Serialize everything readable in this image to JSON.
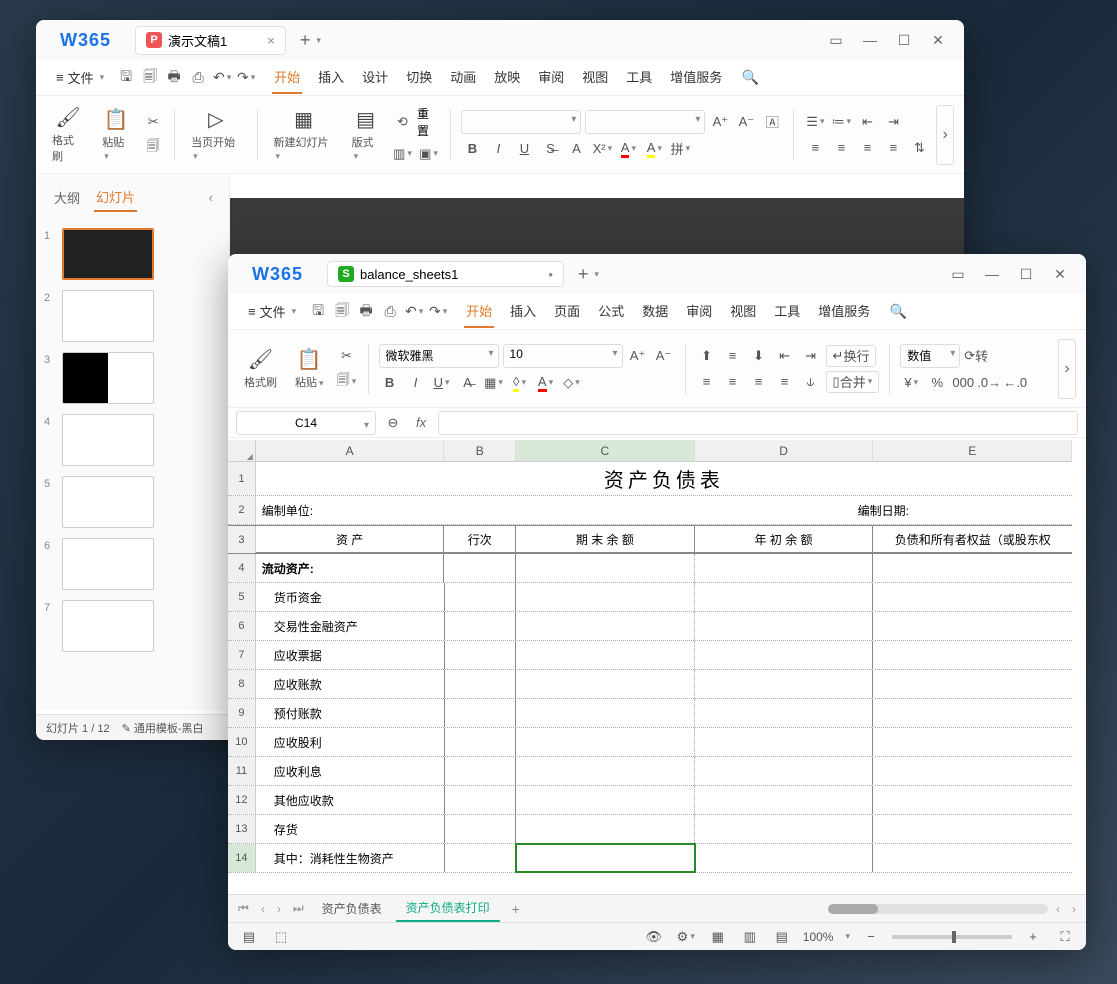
{
  "logo": "W365",
  "ppt": {
    "tab_title": "演示文稿1",
    "menu_file": "文件",
    "menus": [
      "开始",
      "插入",
      "设计",
      "切换",
      "动画",
      "放映",
      "审阅",
      "视图",
      "工具",
      "增值服务"
    ],
    "active_menu": 0,
    "ribbon": {
      "format_painter": "格式刷",
      "paste": "粘贴",
      "from_start": "当页开始",
      "new_slide": "新建幻灯片",
      "layout": "版式",
      "reset": "重置"
    },
    "side": {
      "outline": "大纲",
      "slides": "幻灯片"
    },
    "status": {
      "slide_pos": "幻灯片 1 / 12",
      "template": "通用模板-黑白"
    },
    "thumb_count": 7
  },
  "ss": {
    "tab_title": "balance_sheets1",
    "menu_file": "文件",
    "menus": [
      "开始",
      "插入",
      "页面",
      "公式",
      "数据",
      "审阅",
      "视图",
      "工具",
      "增值服务"
    ],
    "active_menu": 0,
    "ribbon": {
      "format_painter": "格式刷",
      "paste": "粘贴",
      "font_name": "微软雅黑",
      "font_size": "10",
      "wrap": "换行",
      "merge": "合并",
      "numfmt": "数值",
      "convert": "转"
    },
    "cell_ref": "C14",
    "columns": [
      "A",
      "B",
      "C",
      "D",
      "E"
    ],
    "selected_col": "C",
    "selected_row": 14,
    "title": "资产负债表",
    "row2_left": "编制单位:",
    "row2_right": "编制日期:",
    "headers": [
      "资 产",
      "行次",
      "期 末 余 额",
      "年 初 余 额",
      "负债和所有者权益（或股东权"
    ],
    "rows": [
      {
        "n": 4,
        "a": "流动资产:",
        "bold": true,
        "indent": false
      },
      {
        "n": 5,
        "a": "货币资金",
        "indent": true
      },
      {
        "n": 6,
        "a": "交易性金融资产",
        "indent": true
      },
      {
        "n": 7,
        "a": "应收票据",
        "indent": true
      },
      {
        "n": 8,
        "a": "应收账款",
        "indent": true
      },
      {
        "n": 9,
        "a": "预付账款",
        "indent": true
      },
      {
        "n": 10,
        "a": "应收股利",
        "indent": true
      },
      {
        "n": 11,
        "a": "应收利息",
        "indent": true
      },
      {
        "n": 12,
        "a": "其他应收款",
        "indent": true
      },
      {
        "n": 13,
        "a": "存货",
        "indent": true
      },
      {
        "n": 14,
        "a": "其中：消耗性生物资产",
        "indent": true
      }
    ],
    "sheet_tabs": [
      "资产负债表",
      "资产负债表打印"
    ],
    "active_sheet": 1,
    "zoom": "100%"
  }
}
